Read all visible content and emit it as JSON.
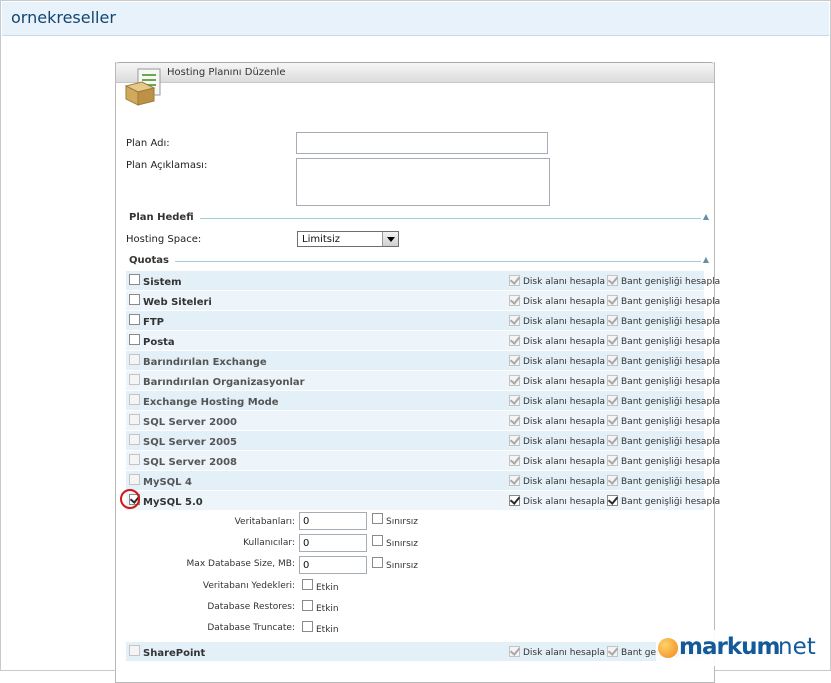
{
  "topbar": {
    "title": "ornekreseller"
  },
  "panel": {
    "title": "Hosting Planını Düzenle"
  },
  "form": {
    "plan_name_label": "Plan Adı:",
    "plan_desc_label": "Plan Açıklaması:",
    "plan_target_section": "Plan Hedefi",
    "hosting_space_label": "Hosting Space:",
    "hosting_space_value": "Limitsiz",
    "quotas_section": "Quotas"
  },
  "quotas": {
    "disk_label": "Disk alanı hesapla",
    "bw_label": "Bant genişliği hesapla",
    "rows": [
      {
        "name": "Sistem"
      },
      {
        "name": "Web Siteleri"
      },
      {
        "name": "FTP"
      },
      {
        "name": "Posta"
      },
      {
        "name": "Barındırılan Exchange"
      },
      {
        "name": "Barındırılan Organizasyonlar"
      },
      {
        "name": "Exchange Hosting Mode"
      },
      {
        "name": "SQL Server 2000"
      },
      {
        "name": "SQL Server 2005"
      },
      {
        "name": "SQL Server 2008"
      },
      {
        "name": "MySQL 4"
      },
      {
        "name": "MySQL 5.0"
      }
    ],
    "last_row": {
      "name": "SharePoint"
    }
  },
  "mysql": {
    "databases_label": "Veritabanları:",
    "databases_value": "0",
    "users_label": "Kullanıcılar:",
    "users_value": "0",
    "max_size_label": "Max Database Size, MB:",
    "max_size_value": "0",
    "unlimited_label": "Sınırsız",
    "backups_label": "Veritabanı Yedekleri:",
    "restores_label": "Database Restores:",
    "truncate_label": "Database Truncate:",
    "enabled_label": "Etkin"
  },
  "watermark": {
    "brand": "markum",
    "suffix": "net"
  },
  "colors": {
    "accent": "#12466f",
    "row_bg": "#e4f0f8",
    "highlight": "#d21616"
  }
}
